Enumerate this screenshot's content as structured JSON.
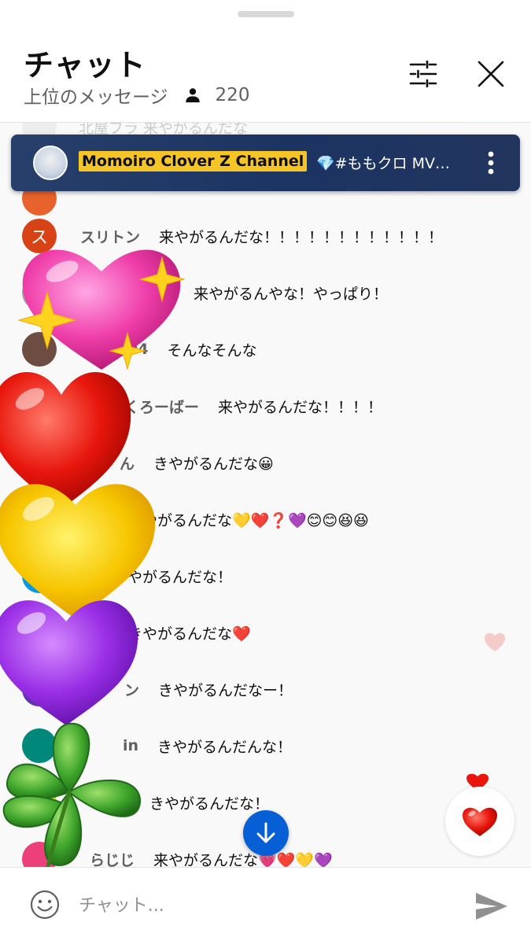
{
  "header": {
    "title": "チャット",
    "subtitle": "上位のメッセージ",
    "viewer_count": "220",
    "icons": {
      "viewers": "person-icon",
      "filter": "tune-icon",
      "close": "close-icon"
    }
  },
  "faded_row_text": "北屋フラ 来やがるんだな",
  "pinned": {
    "author": "Momoiro Clover Z Channel",
    "text": "💎#ももクロ MV…",
    "menu_icon": "more-vert-icon"
  },
  "messages": [
    {
      "avatar_letter": "",
      "avatar_color": "#e8622b",
      "author": "",
      "text": ""
    },
    {
      "avatar_letter": "ス",
      "avatar_color": "#d84315",
      "author": "スリトン",
      "text": "来やがるんだな！！！！！！！！！！！！"
    },
    {
      "avatar_letter": "",
      "avatar_color": "#9e9e9e",
      "author": "",
      "text": "来やがるんやな！やっぱり！"
    },
    {
      "avatar_letter": "",
      "avatar_color": "#6d4c41",
      "author": "04",
      "text": "そんなそんな"
    },
    {
      "avatar_letter": "",
      "avatar_color": "#7cb342",
      "author": "くろーばー",
      "text": "来やがるんだな！！！！"
    },
    {
      "avatar_letter": "",
      "avatar_color": "#8e24aa",
      "author": "ん",
      "text": "きやがるんだな😀"
    },
    {
      "avatar_letter": "",
      "avatar_color": "#f4511e",
      "author": "",
      "text": "きやがるんだな💛❤️❓💜😊😊😆😆"
    },
    {
      "avatar_letter": "",
      "avatar_color": "#039be5",
      "author": "",
      "text": "やがるんだな！"
    },
    {
      "avatar_letter": "",
      "avatar_color": "#43a047",
      "author": "",
      "text": "きやがるんだな❤️"
    },
    {
      "avatar_letter": "",
      "avatar_color": "#5e35b1",
      "author": "ン",
      "text": "きやがるんだなー！"
    },
    {
      "avatar_letter": "",
      "avatar_color": "#00897b",
      "author": "in",
      "text": "きやがるんだんな！"
    },
    {
      "avatar_letter": "",
      "avatar_color": "#c0ca33",
      "author": "ひろ",
      "text": "きやがるんだな！"
    },
    {
      "avatar_letter": "",
      "avatar_color": "#ec407a",
      "author": "らじじ",
      "text": "来やがるんだな💗❤️💛💜"
    }
  ],
  "overlay_reactions": [
    "pink-sparkle-heart-icon",
    "red-heart-icon",
    "yellow-heart-icon",
    "purple-heart-icon",
    "four-leaf-clover-icon"
  ],
  "reaction_button": {
    "icon": "red-heart-icon"
  },
  "scroll_button": {
    "icon": "arrow-down-icon"
  },
  "input": {
    "placeholder": "チャット...",
    "emoji_icon": "smiley-icon",
    "send_icon": "send-icon"
  },
  "colors": {
    "pinned_bg": "#1c3462",
    "author_badge": "#f5c528",
    "accent_blue": "#065fd4"
  }
}
